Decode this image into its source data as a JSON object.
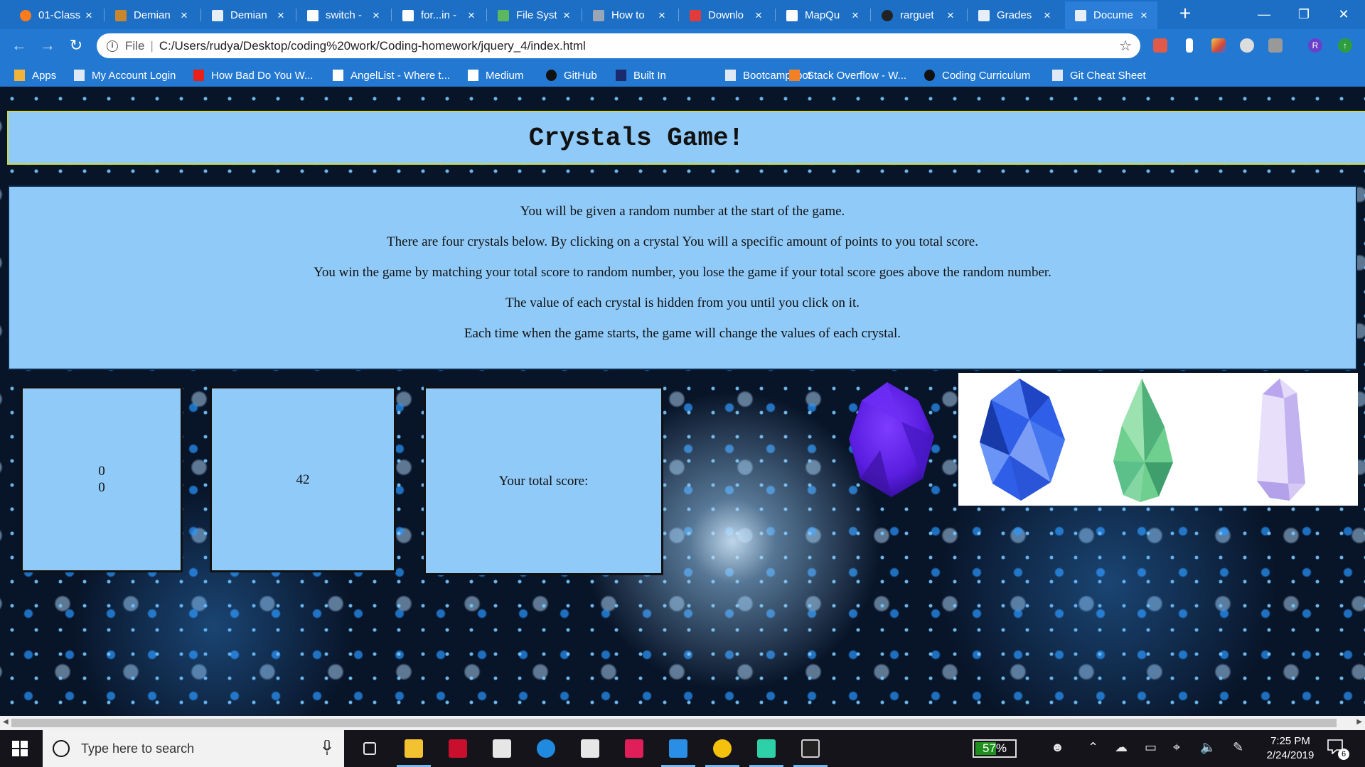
{
  "browser": {
    "tabs": [
      {
        "title": "01-Class",
        "icon": "firefox-icon",
        "active": false
      },
      {
        "title": "Demian",
        "icon": "book-icon",
        "active": false
      },
      {
        "title": "Demian",
        "icon": "document-icon",
        "active": false
      },
      {
        "title": "switch -",
        "icon": "devdocs-icon",
        "active": false
      },
      {
        "title": "for...in -",
        "icon": "devdocs-icon",
        "active": false
      },
      {
        "title": "File Syst",
        "icon": "hexagon-icon",
        "active": false
      },
      {
        "title": "How to",
        "icon": "codepen-icon",
        "active": false
      },
      {
        "title": "Downlo",
        "icon": "download-icon",
        "active": false
      },
      {
        "title": "MapQu",
        "icon": "map-icon",
        "active": false
      },
      {
        "title": "rarguet",
        "icon": "github-icon",
        "active": false
      },
      {
        "title": "Grades",
        "icon": "document-icon",
        "active": false
      },
      {
        "title": "Docume",
        "icon": "document-icon",
        "active": true
      }
    ],
    "address": {
      "scheme": "File",
      "url": "C:/Users/rudya/Desktop/coding%20work/Coding-homework/jquery_4/index.html"
    },
    "bookmarks": [
      {
        "label": "Apps",
        "icon": "apps-grid-icon"
      },
      {
        "label": "My Account Login",
        "icon": "page-icon"
      },
      {
        "label": "How Bad Do You W...",
        "icon": "youtube-icon"
      },
      {
        "label": "AngelList - Where t...",
        "icon": "angellist-icon"
      },
      {
        "label": "Medium",
        "icon": "medium-icon"
      },
      {
        "label": "GitHub",
        "icon": "github-icon"
      },
      {
        "label": "Built In",
        "icon": "builtin-icon"
      },
      {
        "label": "Bootcampspot",
        "icon": "page-icon"
      },
      {
        "label": "Stack Overflow - W...",
        "icon": "stackoverflow-icon"
      },
      {
        "label": "Coding Curriculum",
        "icon": "github-icon"
      },
      {
        "label": "Git Cheat Sheet",
        "icon": "page-icon"
      }
    ],
    "colors": {
      "frame": "#1d6fc5",
      "toolbar": "#2379d2"
    }
  },
  "game": {
    "title": "Crystals Game!",
    "instructions": [
      "You will be given a random number at the start of the game.",
      "There are four crystals below. By clicking on a crystal You will a specific amount of points to you total score.",
      "You win the game by matching your total score to random number, you lose the game if your total score goes above the random number.",
      "The value of each crystal is hidden from you until you click on it.",
      "Each time when the game starts, the game will change the values of each crystal."
    ],
    "counters": {
      "line1": "0",
      "line2": "0"
    },
    "random_number": "42",
    "total_score_label": "Your total score:",
    "crystals": [
      {
        "name": "purple-crystal",
        "color": "#5a1ee0"
      },
      {
        "name": "blue-crystal",
        "color": "#2f5fe8"
      },
      {
        "name": "green-crystal",
        "color": "#6fcf8f"
      },
      {
        "name": "lavender-crystal",
        "color": "#c8b8f0"
      }
    ],
    "colors": {
      "panel": "#90caf9",
      "title_border": "#c9d94a"
    }
  },
  "taskbar": {
    "search_placeholder": "Type here to search",
    "apps": [
      "task-view-icon",
      "file-explorer-icon",
      "mcafee-icon",
      "store-icon",
      "edge-icon",
      "mail-icon",
      "slack-icon",
      "vscode-icon",
      "chrome-icon",
      "gitkraken-icon",
      "terminal-icon"
    ],
    "battery": "57%",
    "time": "7:25 PM",
    "date": "2/24/2019",
    "notifications": "6"
  }
}
